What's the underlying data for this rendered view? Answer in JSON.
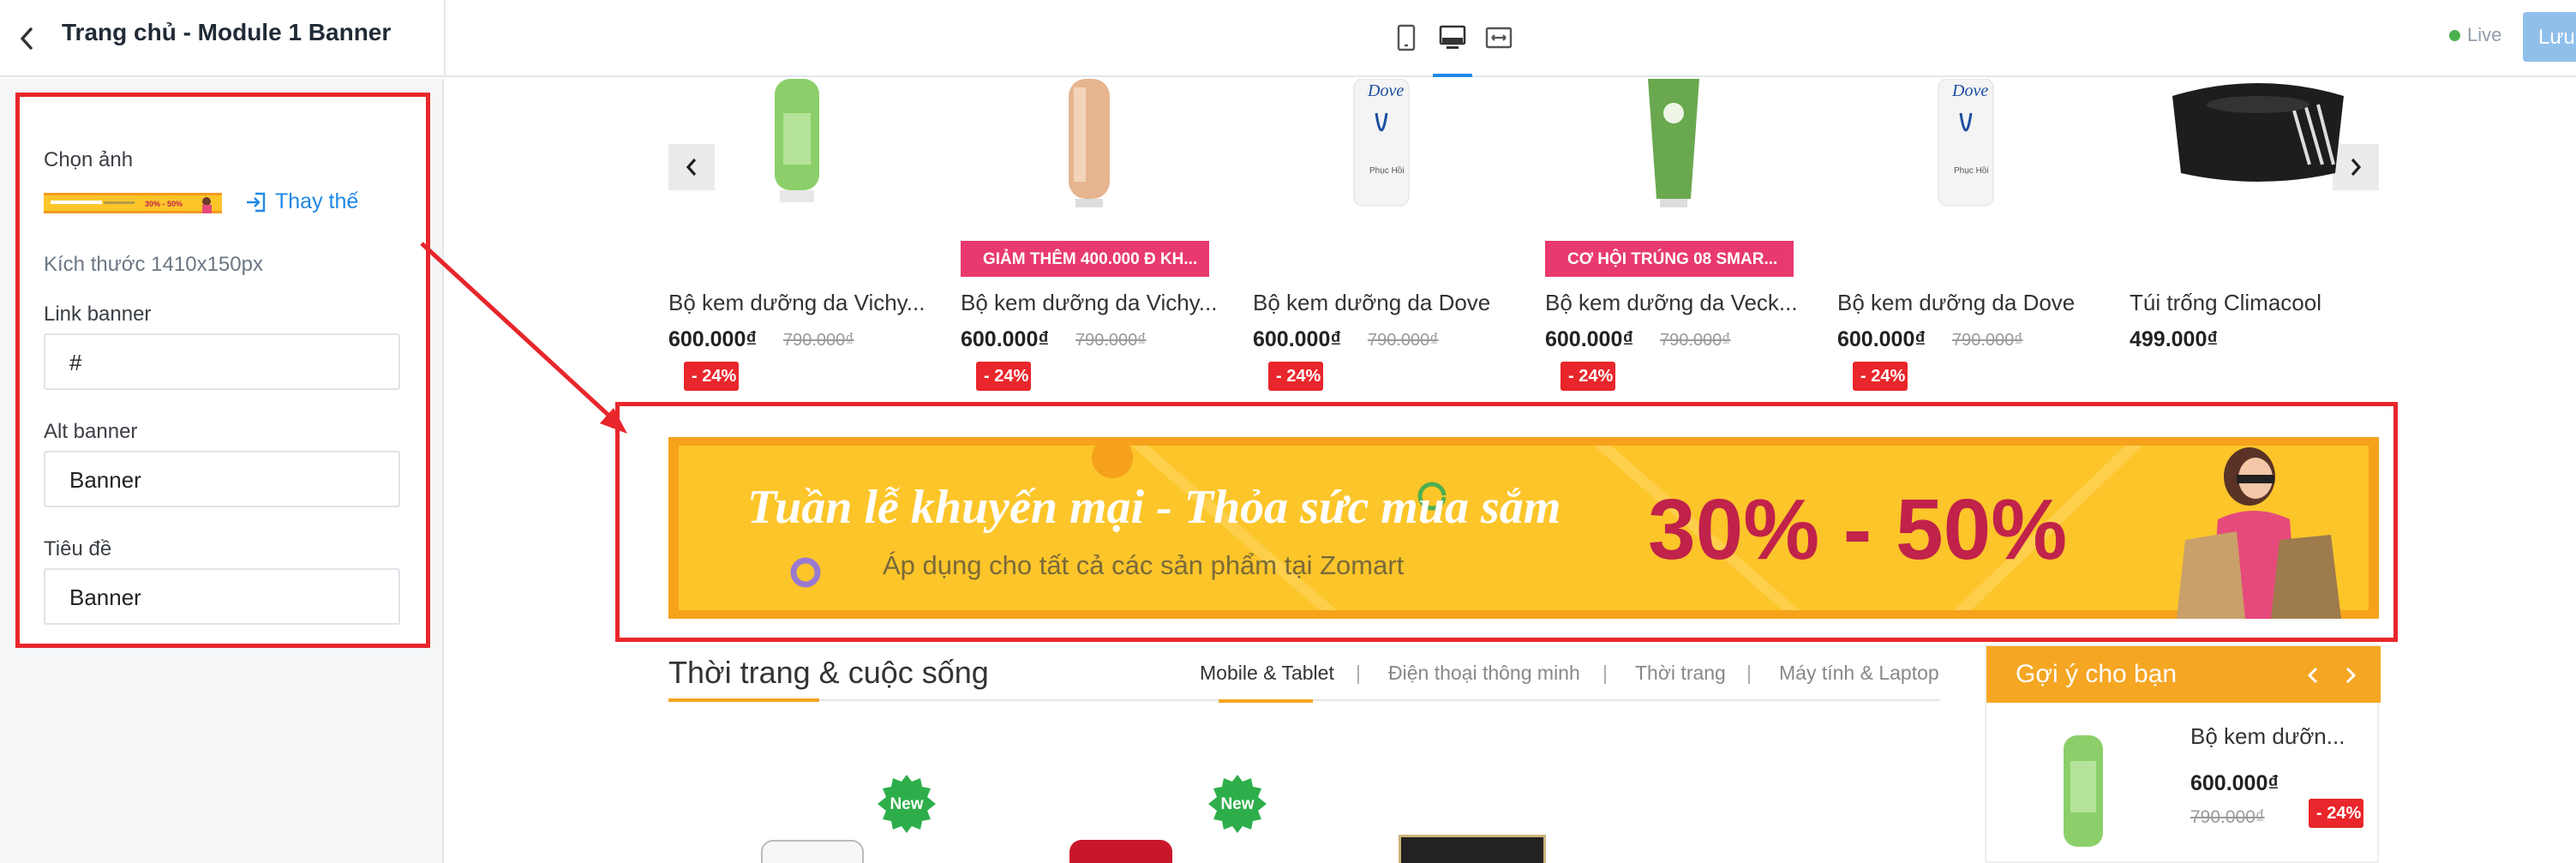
{
  "header": {
    "title": "Trang chủ - Module 1 Banner",
    "live_label": "Live",
    "save_label": "Lưu",
    "devices": [
      "mobile-icon",
      "desktop-icon",
      "fullwidth-icon"
    ]
  },
  "panel": {
    "choose_image_label": "Chọn ảnh",
    "replace_label": "Thay thế",
    "size_text": "Kích thước 1410x150px",
    "link_label": "Link banner",
    "link_value": "#",
    "alt_label": "Alt banner",
    "alt_value": "Banner",
    "title_label": "Tiêu đề",
    "title_value": "Banner"
  },
  "products": [
    {
      "name": "Bộ kem dưỡng da Vichy...",
      "price": "600.000₫",
      "old_price": "790.000₫",
      "discount": "- 24%",
      "tag": ""
    },
    {
      "name": "Bộ kem dưỡng da Vichy...",
      "price": "600.000₫",
      "old_price": "790.000₫",
      "discount": "- 24%",
      "tag": "GIẢM THÊM 400.000 Đ KH..."
    },
    {
      "name": "Bộ kem dưỡng da Dove",
      "price": "600.000₫",
      "old_price": "790.000₫",
      "discount": "- 24%",
      "tag": ""
    },
    {
      "name": "Bộ kem dưỡng da Veck...",
      "price": "600.000₫",
      "old_price": "790.000₫",
      "discount": "- 24%",
      "tag": "CƠ HỘI TRÚNG 08 SMAR..."
    },
    {
      "name": "Bộ kem dưỡng da Dove",
      "price": "600.000₫",
      "old_price": "790.000₫",
      "discount": "- 24%",
      "tag": ""
    },
    {
      "name": "Túi trống Climacool",
      "price": "499.000₫",
      "old_price": "",
      "discount": "",
      "tag": ""
    }
  ],
  "banner": {
    "headline": "Tuần lễ khuyến mại - Thỏa sức mua sắm",
    "subline": "Áp dụng cho tất cả các sản phẩm tại Zomart",
    "percent": "30% - 50%"
  },
  "section": {
    "title": "Thời trang & cuộc sống",
    "tabs": [
      "Mobile & Tablet",
      "Điện thoại thông minh",
      "Thời trang",
      "Máy tính & Laptop"
    ],
    "new_badge": "New"
  },
  "suggest": {
    "title": "Gợi ý cho bạn",
    "name": "Bộ kem dưỡn...",
    "price": "600.000₫",
    "old_price": "790.000₫",
    "discount": "- 24%"
  },
  "colors": {
    "highlight_red": "#e8262b",
    "accent_orange": "#f5a623",
    "link_blue": "#1e88e5",
    "promo_pink": "#e83a6e",
    "banner_yellow": "#fcc52a"
  }
}
